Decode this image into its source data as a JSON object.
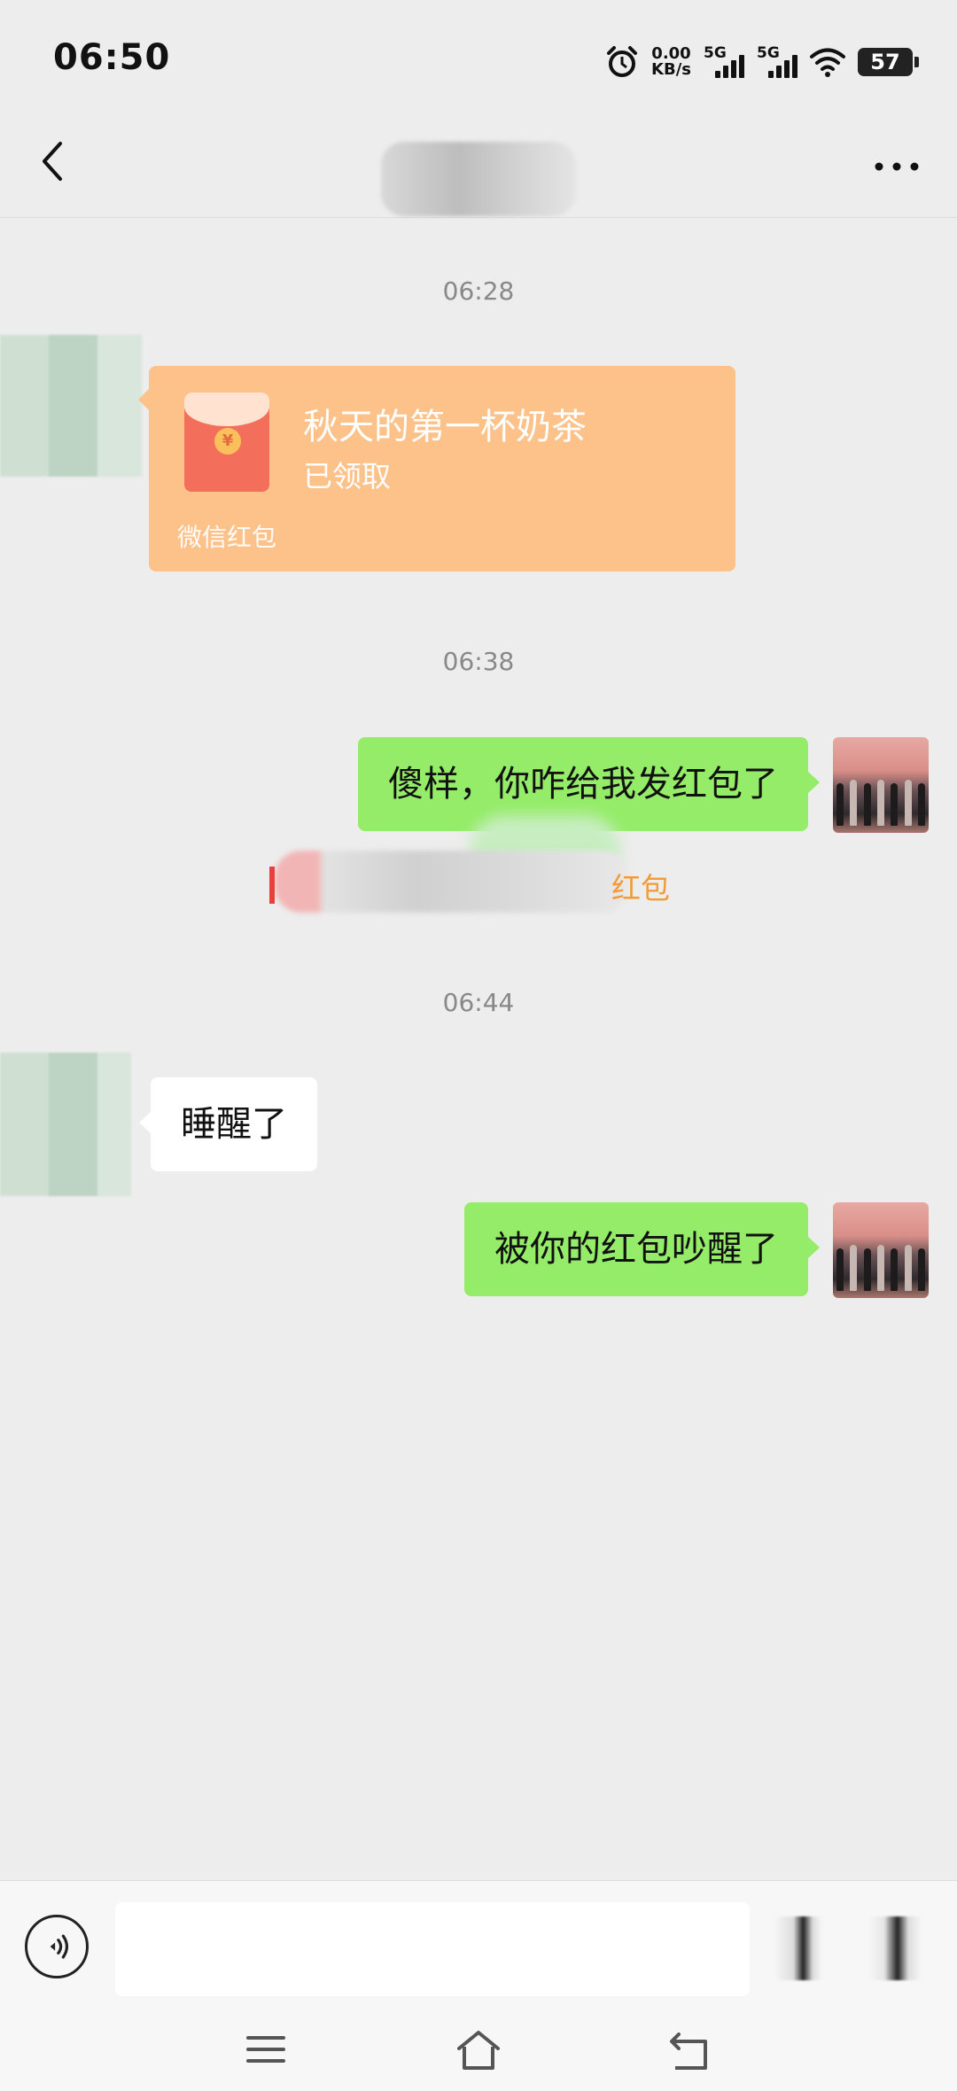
{
  "status_bar": {
    "time": "06:50",
    "net_speed_value": "0.00",
    "net_speed_unit": "KB/s",
    "signal1_label": "5G",
    "signal2_label": "5G",
    "battery": "57",
    "icons": [
      "alarm-icon",
      "signal-icon",
      "signal-icon",
      "wifi-icon",
      "battery-icon"
    ]
  },
  "nav": {
    "back_icon": "chevron-left-icon",
    "more_icon": "more-dots-icon"
  },
  "messages": {
    "time1": "06:28",
    "red_packet": {
      "title": "秋天的第一杯奶茶",
      "status": "已领取",
      "footer": "微信红包",
      "coin_symbol": "¥",
      "color": "#fcc28a"
    },
    "time2": "06:38",
    "msg_sent_1": "傻样，你咋给我发红包了",
    "system_note_visible": "红包",
    "time3": "06:44",
    "msg_received_1": "睡醒了",
    "msg_sent_2": "被你的红包吵醒了"
  },
  "colors": {
    "sent_bubble": "#95ec69",
    "received_bubble": "#ffffff",
    "background": "#ededed",
    "note_orange": "#f29b38"
  },
  "input_bar": {
    "voice_icon": "voice-icon",
    "text_value": ""
  },
  "system_nav": {
    "icons": [
      "menu-icon",
      "home-icon",
      "back-icon"
    ]
  }
}
